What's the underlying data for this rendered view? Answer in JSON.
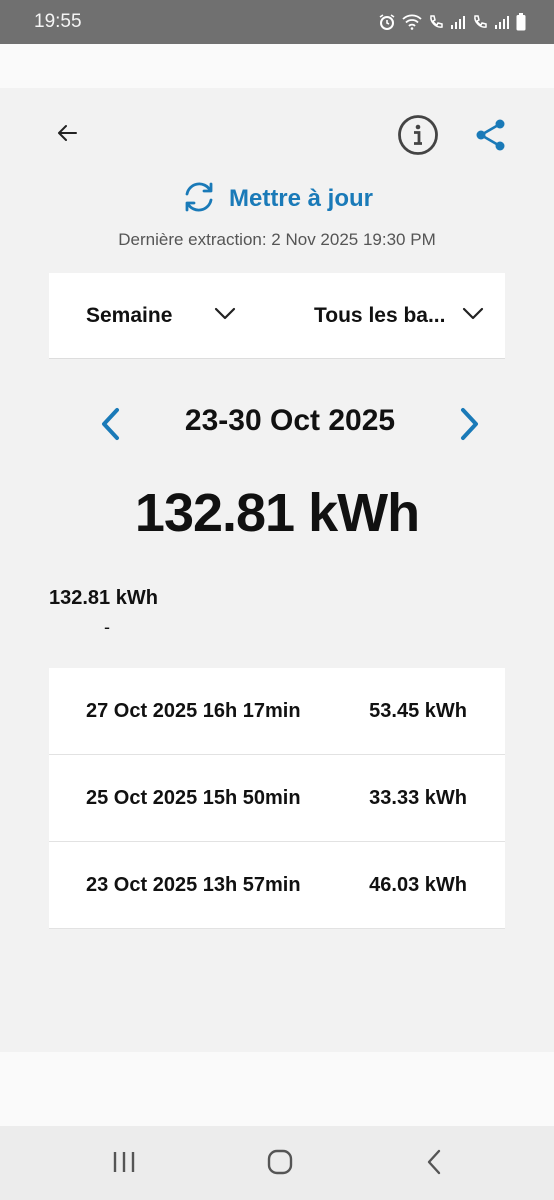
{
  "status_bar": {
    "time": "19:55",
    "icons": [
      "alarm-icon",
      "wifi-icon",
      "wifi-call-icon",
      "signal-1-icon",
      "wifi-call-icon",
      "signal-2-icon",
      "battery-icon"
    ]
  },
  "app_bar": {
    "back_icon": "arrow-left-icon",
    "info_icon": "info-circle-icon",
    "share_icon": "share-icon"
  },
  "refresh": {
    "label": "Mettre à jour",
    "icon": "refresh-icon",
    "accent_color": "#1a7ab8"
  },
  "last_extraction": "Dernière extraction: 2 Nov 2025 19:30 PM",
  "filters": {
    "period": "Semaine",
    "scope": "Tous les ba..."
  },
  "period_nav": {
    "label": "23-30 Oct 2025"
  },
  "total": {
    "big": "132.81 kWh",
    "small": "132.81 kWh",
    "dash": "-"
  },
  "sessions": [
    {
      "date": "27 Oct 2025 16h 17min",
      "energy": "53.45 kWh"
    },
    {
      "date": "25 Oct 2025 15h 50min",
      "energy": "33.33 kWh"
    },
    {
      "date": "23 Oct 2025 13h 57min",
      "energy": "46.03 kWh"
    }
  ]
}
